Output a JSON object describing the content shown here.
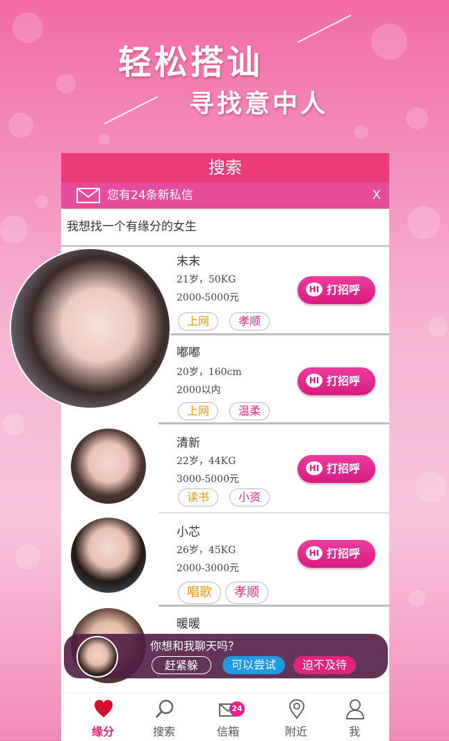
{
  "hero": {
    "headline": "轻松搭讪",
    "subline": "寻找意中人"
  },
  "header": {
    "title": "搜索"
  },
  "notice": {
    "text": "您有24条新私信",
    "close": "X"
  },
  "prompt": "我想找一个有缘分的女生",
  "greet_label": "打招呼",
  "greet_hi": "HI",
  "profiles": [
    {
      "name": "末末",
      "line1": "21岁，50KG",
      "line2": "2000-5000元",
      "tags": [
        "上网",
        "孝顺"
      ]
    },
    {
      "name": "嘟嘟",
      "line1": "20岁，160cm",
      "line2": "2000以内",
      "tags": [
        "上网",
        "温柔"
      ]
    },
    {
      "name": "清新",
      "line1": "22岁，44KG",
      "line2": "3000-5000元",
      "tags": [
        "读书",
        "小资"
      ]
    },
    {
      "name": "小芯",
      "line1": "26岁，45KG",
      "line2": "2000-3000元",
      "tags": [
        "唱歌",
        "孝顺"
      ]
    },
    {
      "name": "暖暖"
    }
  ],
  "popup": {
    "question": "你想和我聊天吗？",
    "buttons": [
      "赶紧躲",
      "可以尝试",
      "迫不及待"
    ]
  },
  "tabs": [
    {
      "label": "缘分",
      "icon": "heart-icon",
      "active": true
    },
    {
      "label": "搜索",
      "icon": "search-icon"
    },
    {
      "label": "信箱",
      "icon": "mail-icon",
      "badge": "24"
    },
    {
      "label": "附近",
      "icon": "location-pin-icon"
    },
    {
      "label": "我",
      "icon": "person-icon"
    }
  ],
  "colors": {
    "accent": "#ec3b78",
    "notice": "#e64b9c",
    "tag_orange": "#e8960c",
    "tag_pink": "#e8238a"
  }
}
